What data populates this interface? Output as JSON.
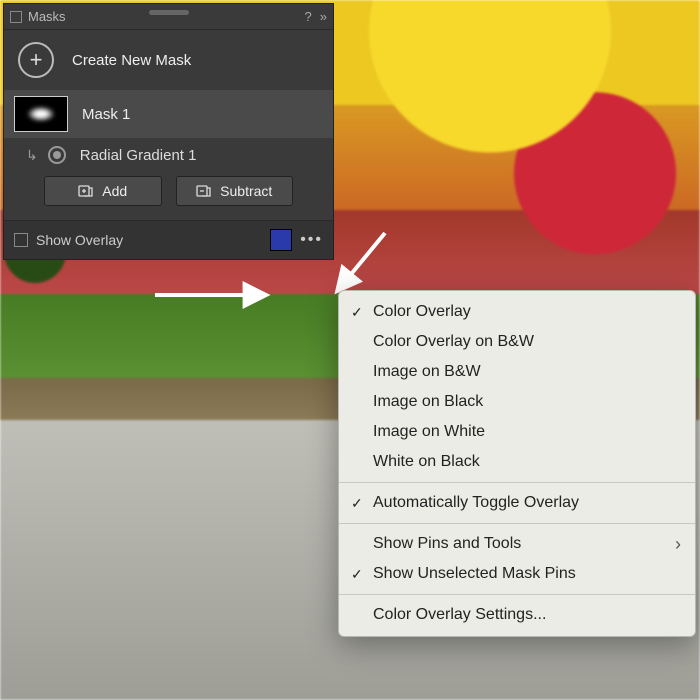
{
  "panel": {
    "title": "Masks",
    "create_label": "Create New Mask",
    "mask": {
      "name": "Mask 1"
    },
    "component": {
      "name": "Radial Gradient 1"
    },
    "add_btn": "Add",
    "subtract_btn": "Subtract",
    "show_overlay": "Show Overlay",
    "overlay_color": "#2a3aaa"
  },
  "menu": {
    "color_overlay": "Color Overlay",
    "color_overlay_bw": "Color Overlay on B&W",
    "image_bw": "Image on B&W",
    "image_black": "Image on Black",
    "image_white": "Image on White",
    "white_black": "White on Black",
    "auto_toggle": "Automatically Toggle Overlay",
    "show_pins": "Show Pins and Tools",
    "show_unselected": "Show Unselected Mask Pins",
    "overlay_settings": "Color Overlay Settings..."
  }
}
